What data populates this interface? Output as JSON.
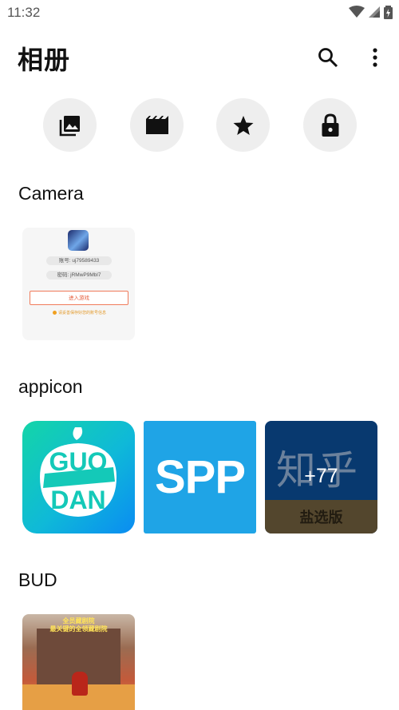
{
  "status_bar": {
    "time": "11:32"
  },
  "header": {
    "title": "相册"
  },
  "quick_actions": [
    {
      "icon": "photo-library-icon"
    },
    {
      "icon": "video-icon"
    },
    {
      "icon": "star-icon"
    },
    {
      "icon": "lock-icon"
    }
  ],
  "albums": [
    {
      "name": "Camera",
      "thumbs": [
        {
          "account": "账号:  uj79589433",
          "password": "密码:  jRMwP9Mbl7",
          "enter": "进入游戏",
          "note": "请妥善保存好您的账号信息"
        }
      ]
    },
    {
      "name": "appicon",
      "thumbs": [
        {
          "icon": "guodan-app-icon"
        },
        {
          "label": "SPP"
        },
        {
          "top": "知乎",
          "bottom": "盐选版",
          "more_count": "+77"
        }
      ]
    },
    {
      "name": "BUD",
      "thumbs": [
        {
          "caption_line1": "全员藏剧院",
          "caption_line2": "最关键的全领藏剧院"
        }
      ]
    }
  ],
  "colors": {
    "circle_bg": "#eeeeee",
    "spp_blue": "#1fa4e6",
    "zhihu_blue": "#0b4a8f"
  }
}
